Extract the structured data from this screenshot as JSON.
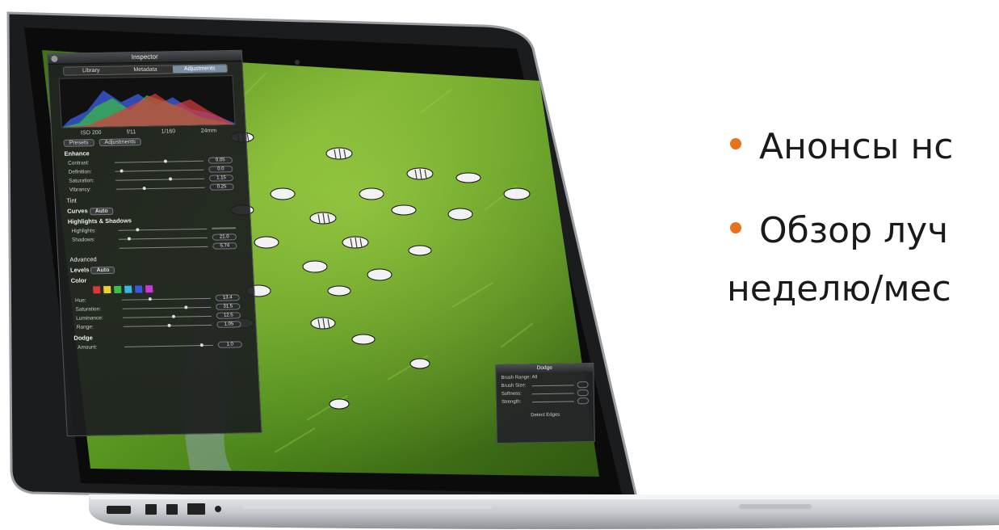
{
  "slide": {
    "bullets": [
      "Анонсы нс",
      "Обзор луч",
      "неделю/мес"
    ],
    "bullet_color": "#e8711e"
  },
  "inspector": {
    "title": "Inspector",
    "tabs": [
      "Library",
      "Metadata",
      "Adjustments"
    ],
    "active_tab": "Adjustments",
    "meta": [
      "ISO 200",
      "f/11",
      "1/160",
      "24mm"
    ],
    "presets_label": "Presets",
    "adjustments_label": "Adjustments",
    "sections": {
      "enhance": {
        "title": "Enhance",
        "rows": [
          {
            "label": "Contrast:",
            "value": "0.05"
          },
          {
            "label": "Definition:",
            "value": "0.0"
          },
          {
            "label": "Saturation:",
            "value": "1.15"
          },
          {
            "label": "Vibrancy:",
            "value": "0.25"
          }
        ],
        "tint": "Tint"
      },
      "curves": {
        "title": "Curves",
        "auto": "Auto"
      },
      "highlights": {
        "title": "Highlights & Shadows",
        "rows": [
          {
            "label": "Highlights:",
            "value": ""
          },
          {
            "label": "Shadows:",
            "value": "21.0"
          },
          {
            "label": "",
            "value": "5.74"
          }
        ],
        "advanced": "Advanced"
      },
      "levels": {
        "title": "Levels",
        "auto": "Auto"
      },
      "color": {
        "title": "Color",
        "swatches": [
          "#d83a3a",
          "#e8d23a",
          "#3ac04a",
          "#3ab8d8",
          "#3a58d8",
          "#c83ad8"
        ],
        "rows": [
          {
            "label": "Hue:",
            "value": "13.4"
          },
          {
            "label": "Saturation:",
            "value": "31.5"
          },
          {
            "label": "Luminance:",
            "value": "12.5"
          },
          {
            "label": "Range:",
            "value": "1.05"
          }
        ]
      },
      "dodge": {
        "title": "Dodge",
        "rows": [
          {
            "label": "Amount:",
            "value": "1.0"
          }
        ]
      }
    }
  },
  "dodge_panel": {
    "title": "Dodge",
    "brush_range": "Brush Range: All",
    "rows": [
      "Brush Size:",
      "Softness:",
      "Strength:"
    ],
    "detect_edges": "Detect Edges"
  },
  "colors": {
    "grass_dark": "#2f5a10",
    "grass_light": "#8fc23a",
    "bezel": "#0b0b0c",
    "aluminum": "#c9ccd0"
  }
}
